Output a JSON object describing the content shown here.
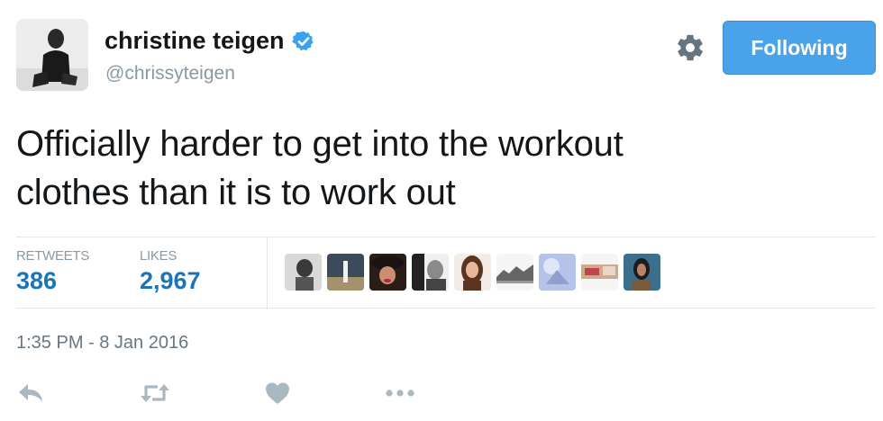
{
  "header": {
    "display_name": "christine teigen",
    "handle": "@chrissyteigen",
    "verified": true,
    "follow_button_label": "Following",
    "accent_color": "#4aa3ea"
  },
  "tweet": {
    "text_line1": "Officially harder to get into the workout",
    "text_line2": "clothes than it is to work out"
  },
  "stats": {
    "retweets_label": "RETWEETS",
    "retweets_value": "386",
    "likes_label": "LIKES",
    "likes_value": "2,967",
    "value_color": "#1b74b8"
  },
  "likers": [
    {
      "icon": "avatar"
    },
    {
      "icon": "avatar"
    },
    {
      "icon": "avatar"
    },
    {
      "icon": "avatar"
    },
    {
      "icon": "avatar"
    },
    {
      "icon": "avatar"
    },
    {
      "icon": "avatar"
    },
    {
      "icon": "avatar"
    },
    {
      "icon": "avatar"
    }
  ],
  "timestamp": "1:35 PM - 8 Jan 2016",
  "actions": [
    {
      "icon": "reply-icon"
    },
    {
      "icon": "retweet-icon"
    },
    {
      "icon": "like-icon"
    },
    {
      "icon": "more-icon"
    }
  ]
}
